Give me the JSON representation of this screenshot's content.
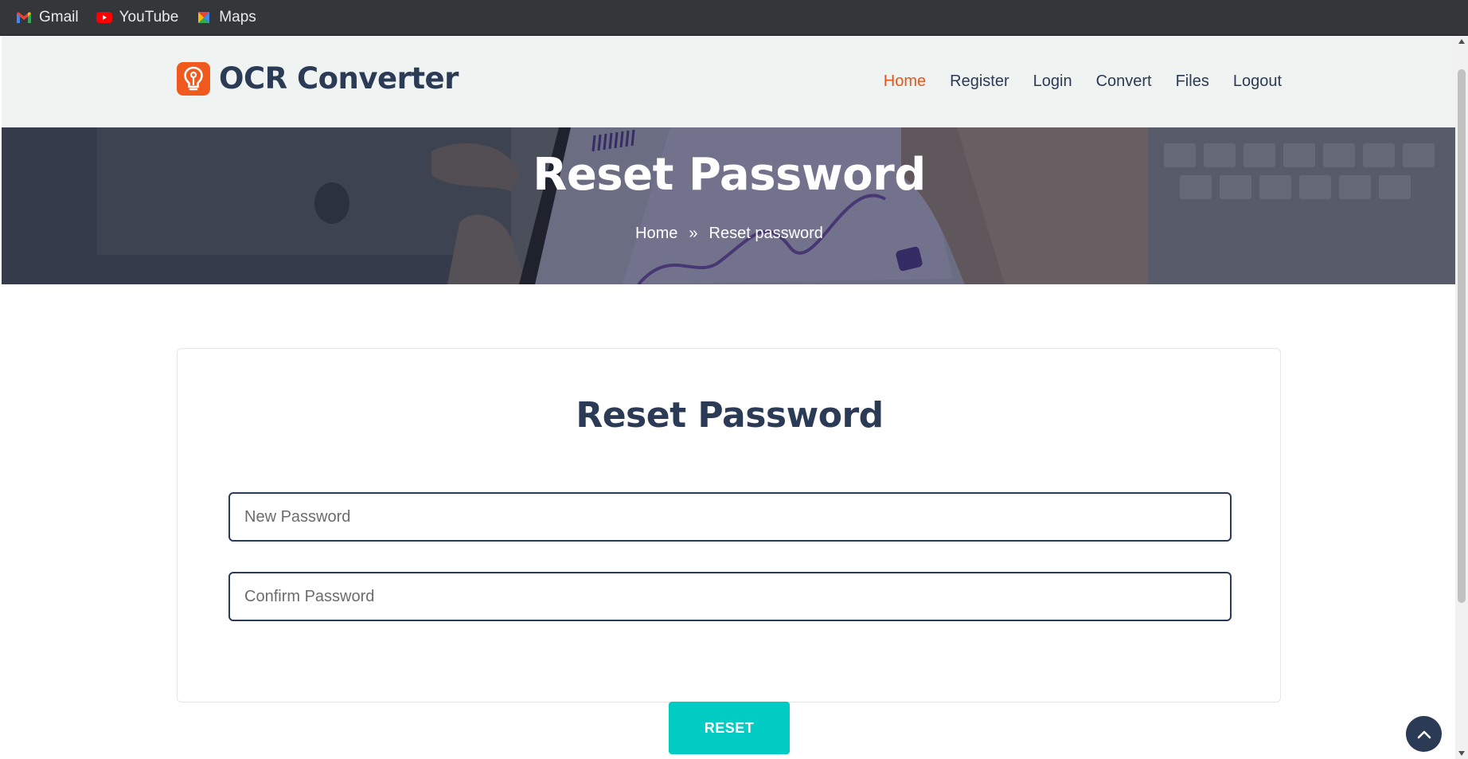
{
  "bookmarks": [
    {
      "label": "Gmail",
      "icon": "gmail-icon"
    },
    {
      "label": "YouTube",
      "icon": "youtube-icon"
    },
    {
      "label": "Maps",
      "icon": "maps-icon"
    }
  ],
  "header": {
    "brand_name": "OCR Converter",
    "brand_icon": "lightbulb-icon",
    "nav": [
      {
        "label": "Home",
        "active": true
      },
      {
        "label": "Register",
        "active": false
      },
      {
        "label": "Login",
        "active": false
      },
      {
        "label": "Convert",
        "active": false
      },
      {
        "label": "Files",
        "active": false
      },
      {
        "label": "Logout",
        "active": false
      }
    ]
  },
  "hero": {
    "title": "Reset Password",
    "breadcrumb": {
      "home": "Home",
      "separator": "»",
      "current": "Reset password"
    }
  },
  "form": {
    "title": "Reset Password",
    "new_password": {
      "value": "",
      "placeholder": "New Password"
    },
    "confirm_password": {
      "value": "",
      "placeholder": "Confirm Password"
    },
    "submit_label": "RESET"
  },
  "back_to_top_icon": "chevron-up-icon",
  "colors": {
    "brand_orange": "#f15a1e",
    "nav_active": "#e8541c",
    "navy": "#2b3a55",
    "reset_button": "#00ccc3",
    "header_bg": "#eff3f1"
  }
}
